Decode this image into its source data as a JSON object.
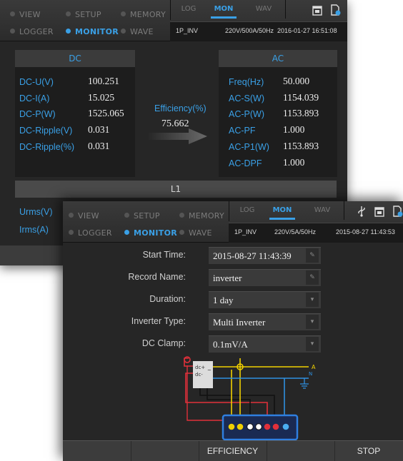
{
  "main_window": {
    "modes": [
      {
        "label": "VIEW"
      },
      {
        "label": "SETUP"
      },
      {
        "label": "MEMORY"
      },
      {
        "label": "LOGGER"
      },
      {
        "label": "MONITOR"
      },
      {
        "label": "WAVE"
      }
    ],
    "tabs": [
      {
        "label": "LOG"
      },
      {
        "label": "MON"
      },
      {
        "label": "WAV"
      }
    ],
    "info": {
      "mode": "1P_INV",
      "range": "220V/500A/50Hz",
      "datetime": "2016-01-27 16:51:08"
    },
    "dc": {
      "title": "DC",
      "rows": [
        {
          "label": "DC-U(V)",
          "value": "100.251"
        },
        {
          "label": "DC-I(A)",
          "value": "15.025"
        },
        {
          "label": "DC-P(W)",
          "value": "1525.065"
        },
        {
          "label": "DC-Ripple(V)",
          "value": "0.031"
        },
        {
          "label": "DC-Ripple(%)",
          "value": "0.031"
        }
      ]
    },
    "efficiency": {
      "label": "Efficiency(%)",
      "value": "75.662"
    },
    "ac": {
      "title": "AC",
      "rows": [
        {
          "label": "Freq(Hz)",
          "value": "50.000"
        },
        {
          "label": "AC-S(W)",
          "value": "1154.039"
        },
        {
          "label": "AC-P(W)",
          "value": "1153.893"
        },
        {
          "label": "AC-PF",
          "value": "1.000"
        },
        {
          "label": "AC-P1(W)",
          "value": "1153.893"
        },
        {
          "label": "AC-DPF",
          "value": "1.000"
        }
      ]
    },
    "phase": "L1",
    "urms": "Urms(V)",
    "irms": "Irms(A)"
  },
  "monitor_window": {
    "modes": [
      {
        "label": "VIEW"
      },
      {
        "label": "SETUP"
      },
      {
        "label": "MEMORY"
      },
      {
        "label": "LOGGER"
      },
      {
        "label": "MONITOR"
      },
      {
        "label": "WAVE"
      }
    ],
    "tabs": [
      {
        "label": "LOG"
      },
      {
        "label": "MON"
      },
      {
        "label": "WAV"
      }
    ],
    "info": {
      "mode": "1P_INV",
      "range": "220V/5A/50Hz",
      "datetime": "2015-08-27 11:43:53"
    },
    "fields": [
      {
        "label": "Start Time:",
        "value": "2015-08-27 11:43:39",
        "control": "edit"
      },
      {
        "label": "Record Name:",
        "value": "inverter",
        "control": "edit"
      },
      {
        "label": "Duration:",
        "value": "1 day",
        "control": "dropdown"
      },
      {
        "label": "Inverter Type:",
        "value": "Multi Inverter",
        "control": "dropdown"
      },
      {
        "label": "DC Clamp:",
        "value": "0.1mV/A",
        "control": "dropdown"
      }
    ],
    "diagram": {
      "dc_plus": "dc+",
      "dc_minus": "dc-",
      "line": "A",
      "neutral": "N"
    },
    "buttons": [
      {
        "label": ""
      },
      {
        "label": ""
      },
      {
        "label": "EFFICIENCY"
      },
      {
        "label": ""
      },
      {
        "label": "STOP"
      }
    ]
  },
  "colors": {
    "accent": "#3aa0e6",
    "background": "#262626",
    "red": "#e0303a",
    "yellow": "#f0d000",
    "blue": "#2f90e0"
  }
}
